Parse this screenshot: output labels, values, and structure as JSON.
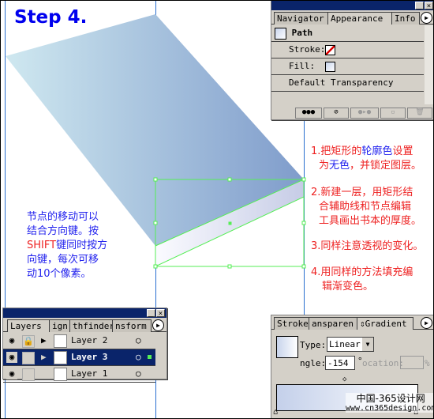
{
  "title": "Step 4.",
  "appearance_panel": {
    "tabs": [
      "Navigator",
      "Appearance",
      "Info"
    ],
    "item_title": "Path",
    "stroke_label": "Stroke:",
    "fill_label": "Fill:",
    "transparency_label": "Default Transparency"
  },
  "instructions": [
    {
      "num": "1.",
      "parts": [
        {
          "t": "把矩形的",
          "c": "red"
        },
        {
          "t": "轮廓色",
          "c": "blue"
        },
        {
          "t": "设置",
          "c": "red"
        }
      ],
      "line2": [
        {
          "t": "为",
          "c": "red"
        },
        {
          "t": "无色",
          "c": "blue"
        },
        {
          "t": "，并锁定图层。",
          "c": "red"
        }
      ]
    },
    {
      "text": "2.新建一层，用矩形结"
    },
    {
      "text": "合辅助线和节点编辑"
    },
    {
      "text": "工具画出书本的厚度。"
    },
    {
      "text": "3.同样注意透视的变化。"
    },
    {
      "text": "4.用同样的方法填充编"
    },
    {
      "text": "辑渐变色。"
    }
  ],
  "tip": {
    "line1": "节点的移动可以",
    "line2": "结合方向键。按",
    "shift": "SHIFT",
    "line3": "键同时按方",
    "line4": "向键，每次可移",
    "line5": "动10个像素。"
  },
  "layers_panel": {
    "tabs": [
      "Layers",
      "ign",
      "thfinder",
      "nsform"
    ],
    "layers": [
      {
        "name": "Layer 2",
        "locked": true,
        "selected": false
      },
      {
        "name": "Layer 3",
        "locked": false,
        "selected": true
      },
      {
        "name": "Layer 1",
        "locked": false,
        "selected": false
      }
    ]
  },
  "gradient_panel": {
    "tabs": [
      "Stroke",
      "ansparen",
      "Gradient"
    ],
    "type_label": "Type:",
    "type_value": "Linear",
    "angle_label": "ngle:",
    "angle_value": "-154",
    "degree": "°",
    "location_label": "ocation:",
    "percent": "%"
  },
  "watermark": {
    "line1": "中国-365设计网",
    "line2": "www.cn365design.com"
  },
  "colors": {
    "title": "#0000ee",
    "instruction": "#ee2222",
    "tip": "#2222ee",
    "selection": "#55ee55",
    "panel_title": "#0a246a"
  }
}
